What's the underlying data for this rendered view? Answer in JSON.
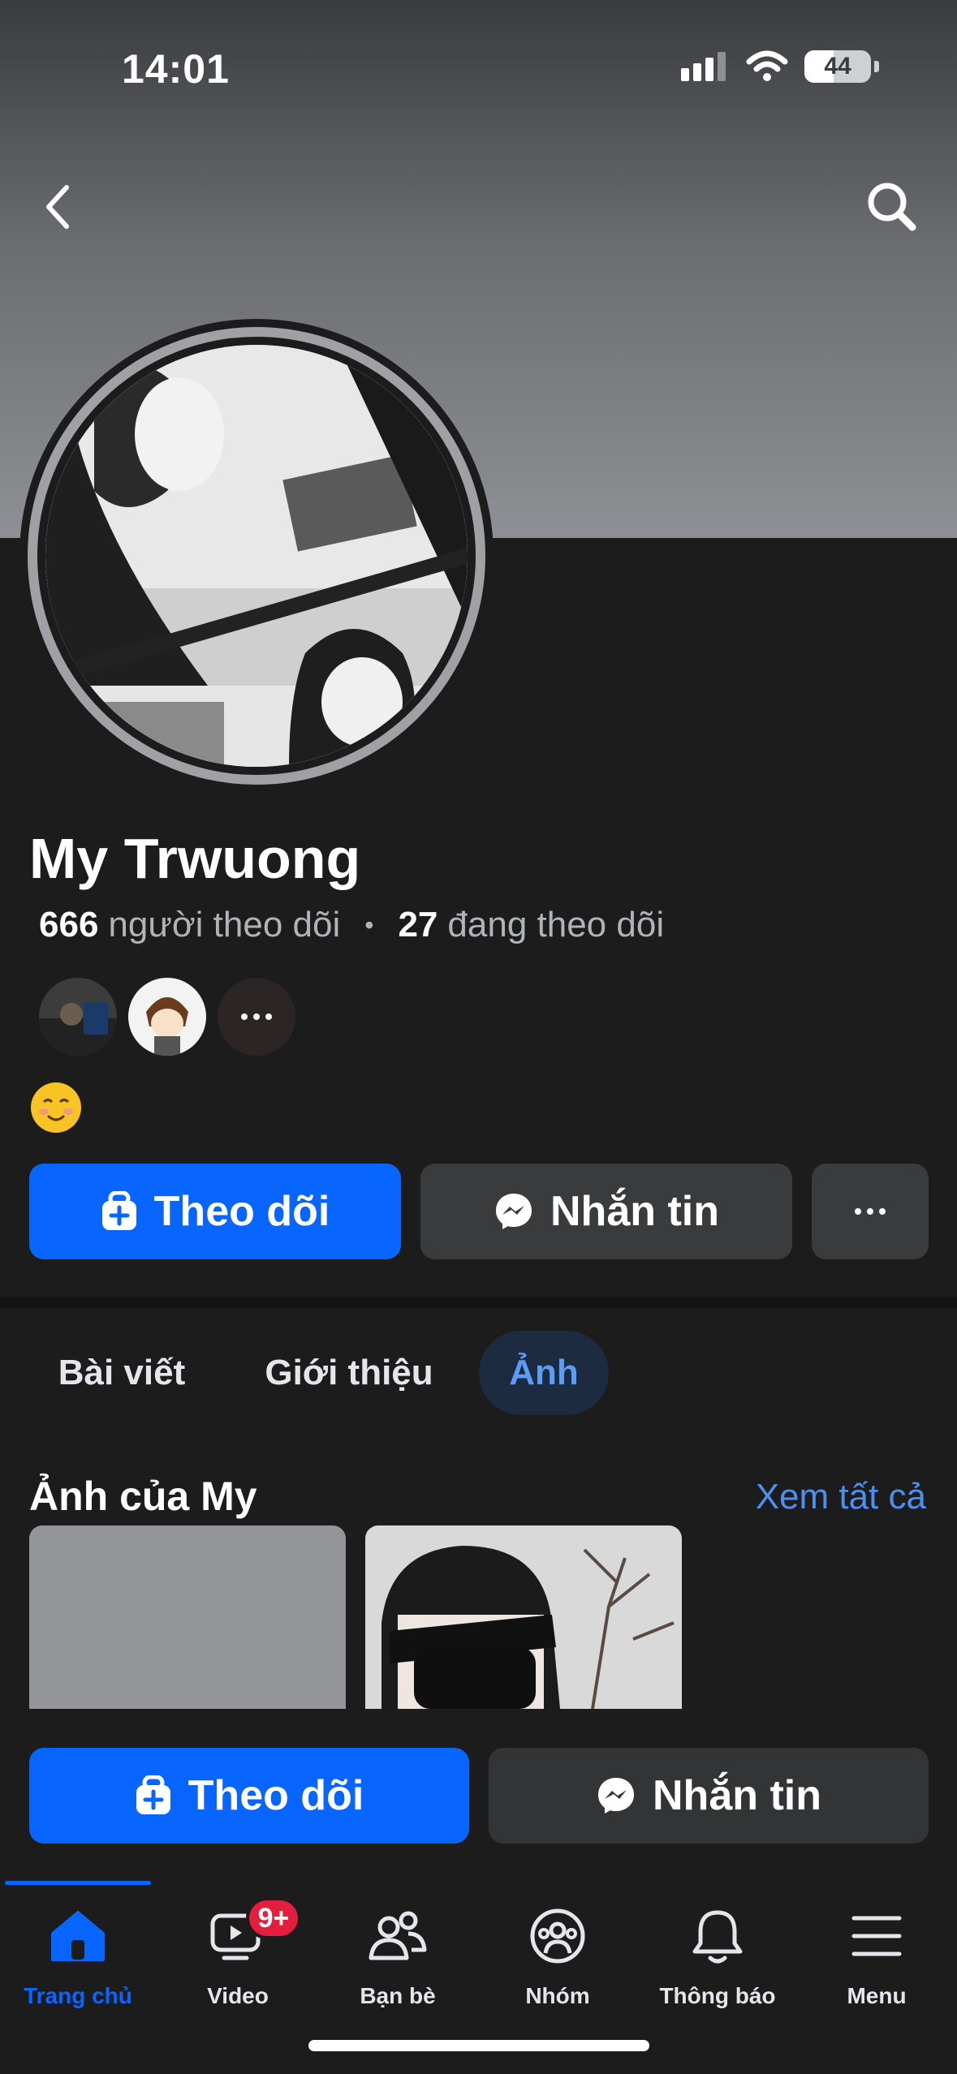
{
  "status_bar": {
    "time": "14:01",
    "battery": "44"
  },
  "profile": {
    "name": "My Trwuong",
    "followers_count": "666",
    "followers_label": "người theo dõi",
    "following_count": "27",
    "following_label": "đang theo dõi",
    "bio_emoji": "☺️"
  },
  "actions": {
    "follow_label": "Theo dõi",
    "message_label": "Nhắn tin",
    "more_label": "···"
  },
  "tabs": [
    {
      "label": "Bài viết",
      "active": false
    },
    {
      "label": "Giới thiệu",
      "active": false
    },
    {
      "label": "Ảnh",
      "active": true
    }
  ],
  "photos": {
    "title": "Ảnh của My",
    "see_all": "Xem tất cả"
  },
  "sticky_actions": {
    "follow_label": "Theo dõi",
    "message_label": "Nhắn tin"
  },
  "bottom_nav": [
    {
      "label": "Trang chủ",
      "icon": "home-icon",
      "active": true
    },
    {
      "label": "Video",
      "icon": "video-icon",
      "badge": "9+"
    },
    {
      "label": "Bạn bè",
      "icon": "friends-icon"
    },
    {
      "label": "Nhóm",
      "icon": "groups-icon"
    },
    {
      "label": "Thông báo",
      "icon": "bell-icon"
    },
    {
      "label": "Menu",
      "icon": "menu-icon"
    }
  ],
  "colors": {
    "background": "#1c1c1d",
    "accent": "#0866ff",
    "link": "#4d8ff0",
    "badge": "#e41e3f",
    "button_secondary": "#3a3b3c"
  }
}
